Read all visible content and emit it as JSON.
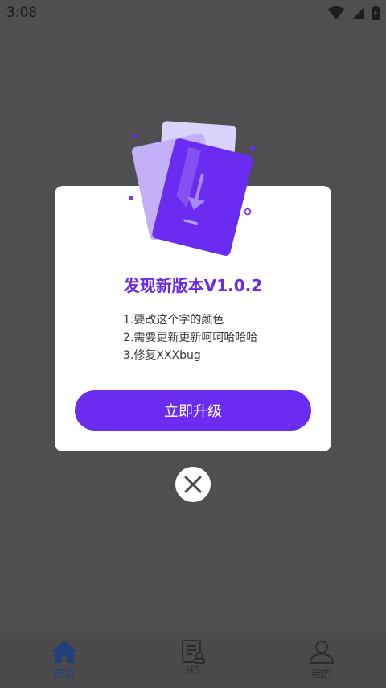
{
  "status_bar": {
    "time": "3:08",
    "icons": [
      "wifi-icon",
      "cell-signal-icon",
      "battery-icon"
    ]
  },
  "update_dialog": {
    "title": "发现新版本V1.0.2",
    "notes": [
      "1.要改这个字的颜色",
      "2.需要更新更新呵呵哈哈哈",
      "3.修复XXXbug"
    ],
    "upgrade_button_label": "立即升级",
    "close_icon": "close-icon",
    "accent_color": "#6a2cf0"
  },
  "bottom_nav": {
    "items": [
      {
        "label": "首页",
        "icon": "home-icon",
        "active": true
      },
      {
        "label": "H5",
        "icon": "document-icon",
        "active": false
      },
      {
        "label": "我的",
        "icon": "user-icon",
        "active": false
      }
    ]
  }
}
